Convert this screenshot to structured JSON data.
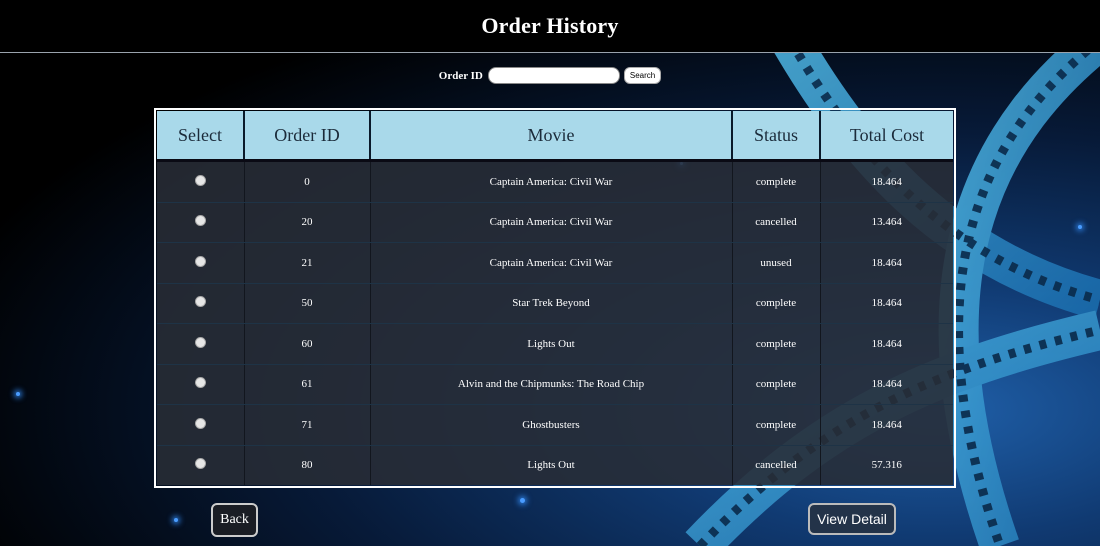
{
  "header": {
    "title": "Order History"
  },
  "search": {
    "label": "Order ID",
    "value": "",
    "button_label": "Search"
  },
  "table": {
    "columns": [
      "Select",
      "Order ID",
      "Movie",
      "Status",
      "Total Cost"
    ],
    "rows": [
      {
        "order_id": "0",
        "movie": "Captain America: Civil War",
        "status": "complete",
        "total": "18.464"
      },
      {
        "order_id": "20",
        "movie": "Captain America: Civil War",
        "status": "cancelled",
        "total": "13.464"
      },
      {
        "order_id": "21",
        "movie": "Captain America: Civil War",
        "status": "unused",
        "total": "18.464"
      },
      {
        "order_id": "50",
        "movie": "Star Trek Beyond",
        "status": "complete",
        "total": "18.464"
      },
      {
        "order_id": "60",
        "movie": "Lights Out",
        "status": "complete",
        "total": "18.464"
      },
      {
        "order_id": "61",
        "movie": "Alvin and the Chipmunks: The Road Chip",
        "status": "complete",
        "total": "18.464"
      },
      {
        "order_id": "71",
        "movie": "Ghostbusters",
        "status": "complete",
        "total": "18.464"
      },
      {
        "order_id": "80",
        "movie": "Lights Out",
        "status": "cancelled",
        "total": "57.316"
      }
    ]
  },
  "footer": {
    "back_label": "Back",
    "detail_label": "View Detail"
  },
  "colors": {
    "header_bg": "#000000",
    "table_head": "#a9d9ea",
    "row_bg": "#282c36",
    "film_blue": "#3aa6d9"
  }
}
